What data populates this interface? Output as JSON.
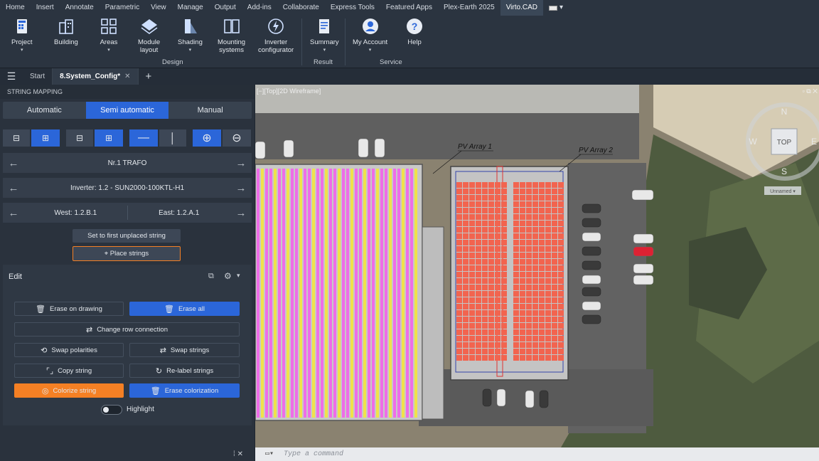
{
  "menu": [
    "Home",
    "Insert",
    "Annotate",
    "Parametric",
    "View",
    "Manage",
    "Output",
    "Add-ins",
    "Collaborate",
    "Express Tools",
    "Featured Apps",
    "Plex-Earth 2025",
    "Virto.CAD"
  ],
  "ribbon": {
    "project": "Project",
    "building": "Building",
    "areas": "Areas",
    "module_layout": [
      "Module",
      "layout"
    ],
    "shading": "Shading",
    "mounting": [
      "Mounting",
      "systems"
    ],
    "inverter": [
      "Inverter",
      "configurator"
    ],
    "summary": "Summary",
    "my_account": "My Account",
    "help": "Help",
    "groups": {
      "design": "Design",
      "result": "Result",
      "service": "Service"
    }
  },
  "tabs": {
    "start": "Start",
    "file": "8.System_Config*"
  },
  "panel": {
    "title": "STRING MAPPING",
    "modes": [
      "Automatic",
      "Semi automatic",
      "Manual"
    ],
    "trafo": "Nr.1 TRAFO",
    "inverter": "Inverter: 1.2 - SUN2000-100KTL-H1",
    "west": "West: 1.2.B.1",
    "east": "East: 1.2.A.1",
    "set_first": "Set to first unplaced string",
    "place_strings": "Place strings",
    "edit": "Edit",
    "erase_on_drawing": "Erase on drawing",
    "erase_all": "Erase all",
    "change_row_connection": "Change row connection",
    "swap_polarities": "Swap polarities",
    "swap_strings": "Swap strings",
    "copy_string": "Copy string",
    "relabel_strings": "Re-label strings",
    "colorize_string": "Colorize string",
    "erase_colorization": "Erase colorization",
    "highlight": "Highlight"
  },
  "viewport": {
    "label": "[−][Top][2D Wireframe]",
    "array1": "PV Array 1",
    "array2": "PV Array 2",
    "compass": {
      "n": "N",
      "w": "W",
      "e": "E",
      "s": "S",
      "top": "TOP"
    },
    "unnamed": "Unnamed ▾"
  },
  "command": {
    "placeholder": "Type a command"
  }
}
